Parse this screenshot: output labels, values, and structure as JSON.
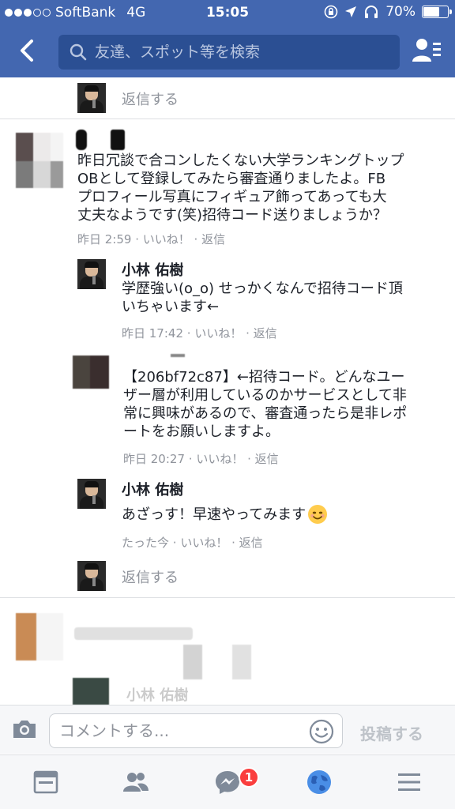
{
  "status_bar": {
    "carrier": "SoftBank",
    "network": "4G",
    "time": "15:05",
    "battery": "70%",
    "battery_level": 0.7,
    "signal_bars": 3
  },
  "nav": {
    "search_placeholder": "友達、スポット等を検索"
  },
  "thread": {
    "top_reply_label": "返信する",
    "comment1": {
      "lines": [
        "昨日冗談で合コンしたくない大学ランキングトップ",
        "OBとして登録してみたら審査通りましたよ。FB",
        "プロフィール写真にフィギュア飾ってあっても大",
        "丈夫なようです(笑)招待コード送りましょうか？"
      ],
      "time": "昨日 2:59",
      "like": "いいね！",
      "reply": "返信"
    },
    "reply1": {
      "name": "小林 佑樹",
      "lines": [
        "学歴強い(o_o) せっかくなんで招待コード頂",
        "いちゃいます←"
      ],
      "time": "昨日 17:42",
      "like": "いいね！",
      "reply": "返信"
    },
    "reply2": {
      "lines": [
        "【206bf72c87】←招待コード。どんなユー",
        "ザー層が利用しているのかサービスとして非",
        "常に興味があるので、審査通ったら是非レポ",
        "ートをお願いしますよ。"
      ],
      "time": "昨日 20:27",
      "like": "いいね！",
      "reply": "返信"
    },
    "reply3": {
      "name": "小林 佑樹",
      "text": "あざっす！早速やってみます",
      "time": "たった今",
      "like": "いいね！",
      "reply": "返信"
    },
    "bottom_reply_label": "返信する",
    "partial_name": "小林 佑樹"
  },
  "composer": {
    "placeholder": "コメントする...",
    "post_label": "投稿する"
  },
  "tabbar": {
    "messenger_badge": "1"
  },
  "colors": {
    "header": "#4367b0",
    "search_bg": "#2b4f93",
    "meta_text": "#90949c",
    "badge": "#fa3e3e"
  }
}
